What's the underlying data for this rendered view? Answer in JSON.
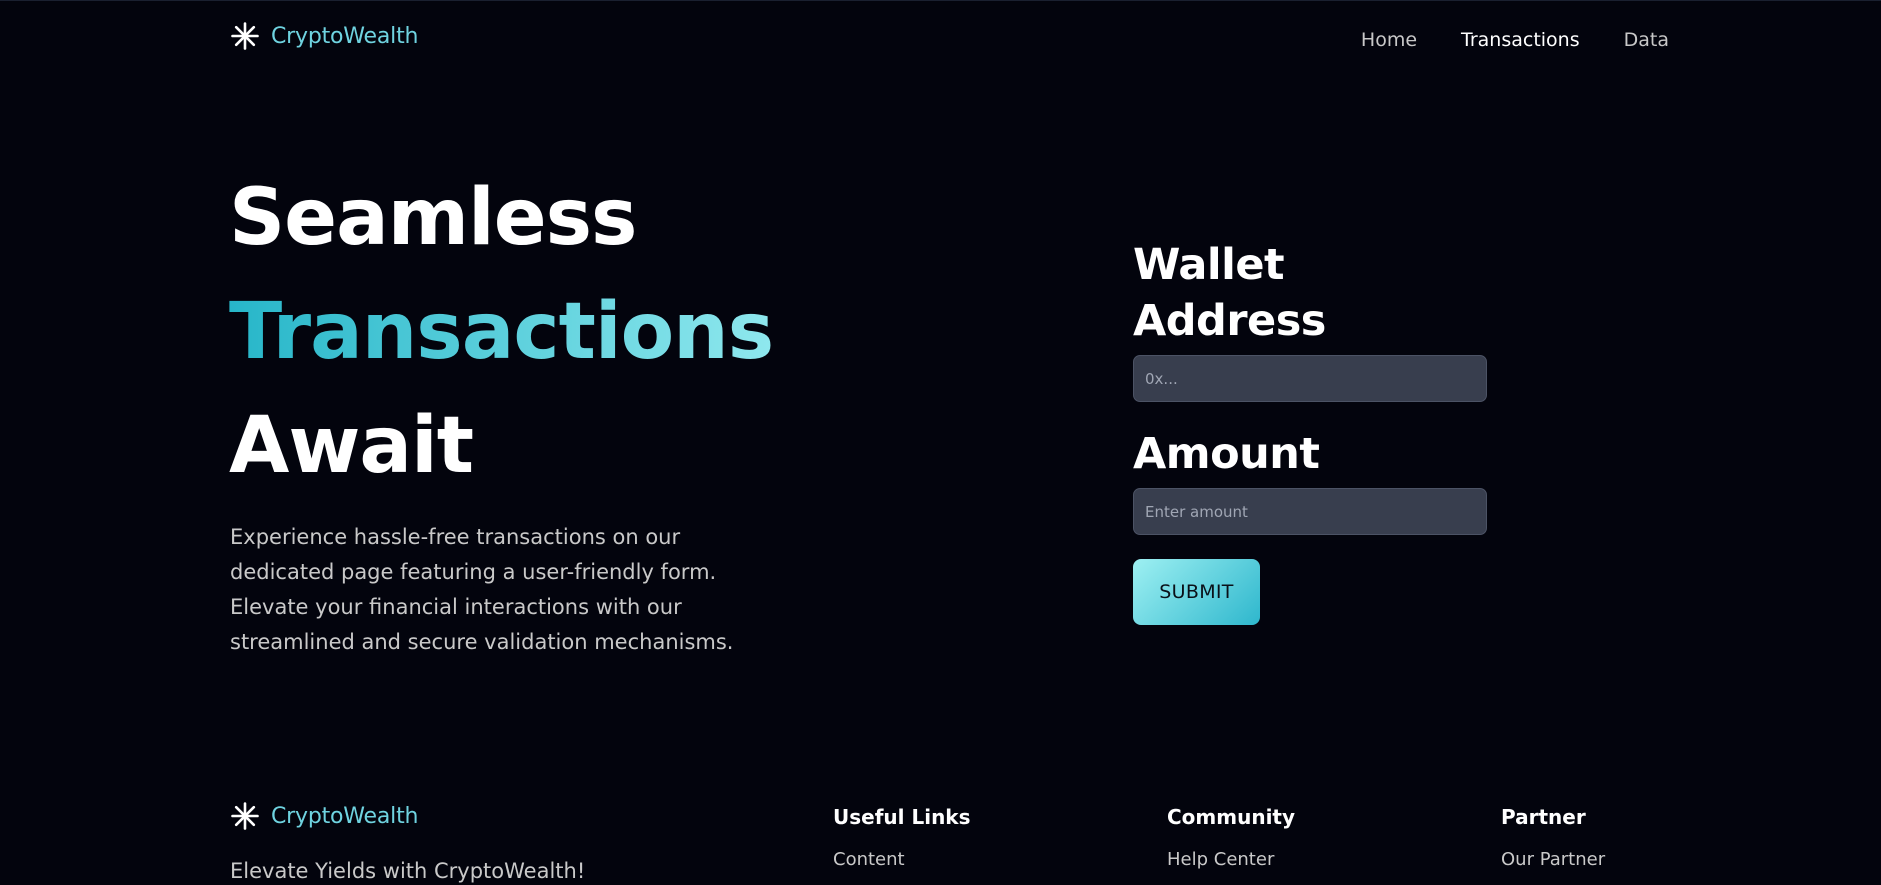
{
  "header": {
    "brand": {
      "name": "CryptoWealth",
      "logo_icon": "asterisk-icon"
    },
    "nav": [
      {
        "label": "Home",
        "active": false
      },
      {
        "label": "Transactions",
        "active": true
      },
      {
        "label": "Data",
        "active": false
      }
    ]
  },
  "hero": {
    "title_line1": "Seamless",
    "title_line2": "Transactions",
    "title_line3": "Await",
    "description": "Experience hassle-free transactions on our dedicated page featuring a user-friendly form. Elevate your financial interactions with our streamlined and secure validation mechanisms."
  },
  "form": {
    "wallet_label": "Wallet Address",
    "wallet_placeholder": "0x...",
    "wallet_value": "",
    "amount_label": "Amount",
    "amount_placeholder": "Enter amount",
    "amount_value": "",
    "submit_label": "SUBMIT"
  },
  "footer": {
    "brand": {
      "name": "CryptoWealth",
      "logo_icon": "asterisk-icon"
    },
    "tagline": "Elevate Yields with CryptoWealth!",
    "columns": [
      {
        "title": "Useful Links",
        "links": [
          "Content"
        ]
      },
      {
        "title": "Community",
        "links": [
          "Help Center"
        ]
      },
      {
        "title": "Partner",
        "links": [
          "Our Partner"
        ]
      }
    ]
  },
  "colors": {
    "background": "#03040d",
    "accent": "#6fd3e0",
    "accent_gradient_start": "#27b6c9",
    "accent_gradient_end": "#8fe8ee",
    "input_background": "#383e4e",
    "muted_text": "#c9c9c9"
  }
}
